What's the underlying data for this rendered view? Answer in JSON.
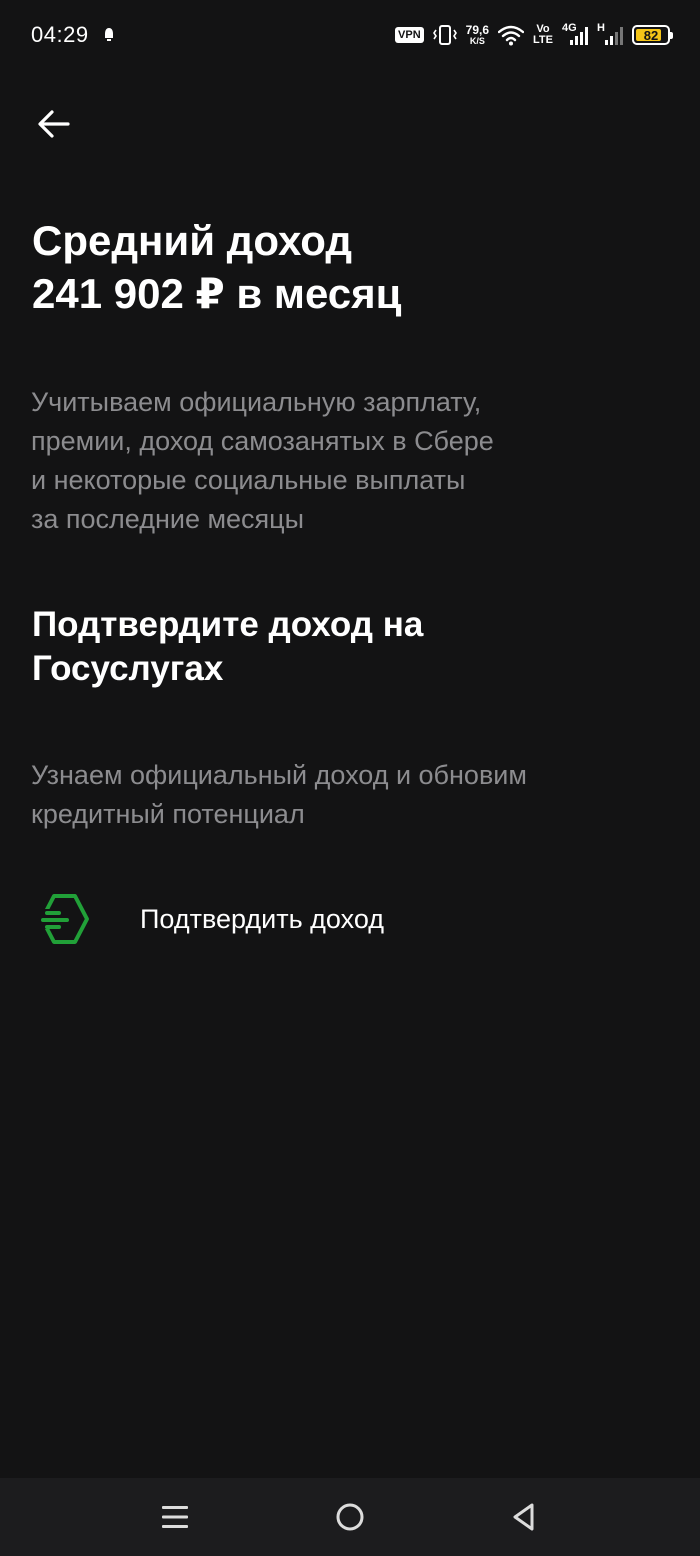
{
  "status_bar": {
    "time": "04:29",
    "vpn": "VPN",
    "speed_value": "79,6",
    "speed_unit": "K/S",
    "volte_top": "Vo",
    "volte_bottom": "LTE",
    "net_4g": "4G",
    "net_h": "H",
    "battery": "82",
    "battery_level": 0.82,
    "battery_color": "#f5c518"
  },
  "header": {
    "back_icon": "arrow-left-icon"
  },
  "income": {
    "title_line1": "Средний доход",
    "title_line2": "241 902 ₽ в месяц",
    "desc_line1": "Учитываем официальную зарплату,",
    "desc_line2": "премии, доход самозанятых в Сбере",
    "desc_line3": "и некоторые социальные выплаты",
    "desc_line4": "за последние месяцы"
  },
  "confirm": {
    "title_line1": "Подтвердите доход на",
    "title_line2": "Госуслугах",
    "desc_line1": "Узнаем официальный доход и обновим",
    "desc_line2": "кредитный потенциал",
    "action_label": "Подтвердить доход",
    "action_icon": "gosuslugi-icon",
    "accent_color": "#21a038"
  },
  "nav": {
    "menu_icon": "recent-apps-icon",
    "home_icon": "home-circle-icon",
    "back_icon": "back-triangle-icon"
  }
}
